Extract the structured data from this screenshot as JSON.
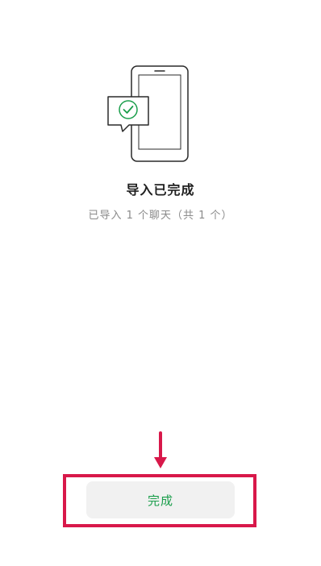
{
  "status": {
    "title": "导入已完成",
    "subtitle": "已导入 1 个聊天（共 1 个）"
  },
  "actions": {
    "done_label": "完成"
  },
  "icons": {
    "illustration": "phone-with-check-bubble-icon",
    "arrow": "arrow-down-icon"
  },
  "colors": {
    "accent_green": "#1a9e4b",
    "highlight_red": "#d8184a"
  }
}
